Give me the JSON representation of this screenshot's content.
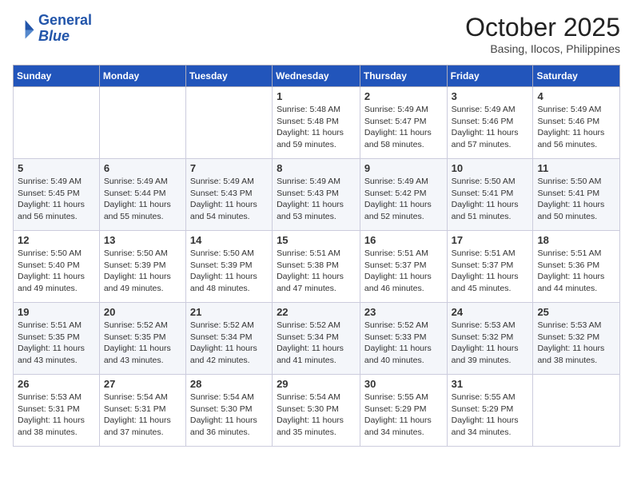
{
  "header": {
    "logo_line1": "General",
    "logo_line2": "Blue",
    "month": "October 2025",
    "location": "Basing, Ilocos, Philippines"
  },
  "weekdays": [
    "Sunday",
    "Monday",
    "Tuesday",
    "Wednesday",
    "Thursday",
    "Friday",
    "Saturday"
  ],
  "weeks": [
    [
      {
        "day": "",
        "info": ""
      },
      {
        "day": "",
        "info": ""
      },
      {
        "day": "",
        "info": ""
      },
      {
        "day": "1",
        "info": "Sunrise: 5:48 AM\nSunset: 5:48 PM\nDaylight: 11 hours\nand 59 minutes."
      },
      {
        "day": "2",
        "info": "Sunrise: 5:49 AM\nSunset: 5:47 PM\nDaylight: 11 hours\nand 58 minutes."
      },
      {
        "day": "3",
        "info": "Sunrise: 5:49 AM\nSunset: 5:46 PM\nDaylight: 11 hours\nand 57 minutes."
      },
      {
        "day": "4",
        "info": "Sunrise: 5:49 AM\nSunset: 5:46 PM\nDaylight: 11 hours\nand 56 minutes."
      }
    ],
    [
      {
        "day": "5",
        "info": "Sunrise: 5:49 AM\nSunset: 5:45 PM\nDaylight: 11 hours\nand 56 minutes."
      },
      {
        "day": "6",
        "info": "Sunrise: 5:49 AM\nSunset: 5:44 PM\nDaylight: 11 hours\nand 55 minutes."
      },
      {
        "day": "7",
        "info": "Sunrise: 5:49 AM\nSunset: 5:43 PM\nDaylight: 11 hours\nand 54 minutes."
      },
      {
        "day": "8",
        "info": "Sunrise: 5:49 AM\nSunset: 5:43 PM\nDaylight: 11 hours\nand 53 minutes."
      },
      {
        "day": "9",
        "info": "Sunrise: 5:49 AM\nSunset: 5:42 PM\nDaylight: 11 hours\nand 52 minutes."
      },
      {
        "day": "10",
        "info": "Sunrise: 5:50 AM\nSunset: 5:41 PM\nDaylight: 11 hours\nand 51 minutes."
      },
      {
        "day": "11",
        "info": "Sunrise: 5:50 AM\nSunset: 5:41 PM\nDaylight: 11 hours\nand 50 minutes."
      }
    ],
    [
      {
        "day": "12",
        "info": "Sunrise: 5:50 AM\nSunset: 5:40 PM\nDaylight: 11 hours\nand 49 minutes."
      },
      {
        "day": "13",
        "info": "Sunrise: 5:50 AM\nSunset: 5:39 PM\nDaylight: 11 hours\nand 49 minutes."
      },
      {
        "day": "14",
        "info": "Sunrise: 5:50 AM\nSunset: 5:39 PM\nDaylight: 11 hours\nand 48 minutes."
      },
      {
        "day": "15",
        "info": "Sunrise: 5:51 AM\nSunset: 5:38 PM\nDaylight: 11 hours\nand 47 minutes."
      },
      {
        "day": "16",
        "info": "Sunrise: 5:51 AM\nSunset: 5:37 PM\nDaylight: 11 hours\nand 46 minutes."
      },
      {
        "day": "17",
        "info": "Sunrise: 5:51 AM\nSunset: 5:37 PM\nDaylight: 11 hours\nand 45 minutes."
      },
      {
        "day": "18",
        "info": "Sunrise: 5:51 AM\nSunset: 5:36 PM\nDaylight: 11 hours\nand 44 minutes."
      }
    ],
    [
      {
        "day": "19",
        "info": "Sunrise: 5:51 AM\nSunset: 5:35 PM\nDaylight: 11 hours\nand 43 minutes."
      },
      {
        "day": "20",
        "info": "Sunrise: 5:52 AM\nSunset: 5:35 PM\nDaylight: 11 hours\nand 43 minutes."
      },
      {
        "day": "21",
        "info": "Sunrise: 5:52 AM\nSunset: 5:34 PM\nDaylight: 11 hours\nand 42 minutes."
      },
      {
        "day": "22",
        "info": "Sunrise: 5:52 AM\nSunset: 5:34 PM\nDaylight: 11 hours\nand 41 minutes."
      },
      {
        "day": "23",
        "info": "Sunrise: 5:52 AM\nSunset: 5:33 PM\nDaylight: 11 hours\nand 40 minutes."
      },
      {
        "day": "24",
        "info": "Sunrise: 5:53 AM\nSunset: 5:32 PM\nDaylight: 11 hours\nand 39 minutes."
      },
      {
        "day": "25",
        "info": "Sunrise: 5:53 AM\nSunset: 5:32 PM\nDaylight: 11 hours\nand 38 minutes."
      }
    ],
    [
      {
        "day": "26",
        "info": "Sunrise: 5:53 AM\nSunset: 5:31 PM\nDaylight: 11 hours\nand 38 minutes."
      },
      {
        "day": "27",
        "info": "Sunrise: 5:54 AM\nSunset: 5:31 PM\nDaylight: 11 hours\nand 37 minutes."
      },
      {
        "day": "28",
        "info": "Sunrise: 5:54 AM\nSunset: 5:30 PM\nDaylight: 11 hours\nand 36 minutes."
      },
      {
        "day": "29",
        "info": "Sunrise: 5:54 AM\nSunset: 5:30 PM\nDaylight: 11 hours\nand 35 minutes."
      },
      {
        "day": "30",
        "info": "Sunrise: 5:55 AM\nSunset: 5:29 PM\nDaylight: 11 hours\nand 34 minutes."
      },
      {
        "day": "31",
        "info": "Sunrise: 5:55 AM\nSunset: 5:29 PM\nDaylight: 11 hours\nand 34 minutes."
      },
      {
        "day": "",
        "info": ""
      }
    ]
  ]
}
